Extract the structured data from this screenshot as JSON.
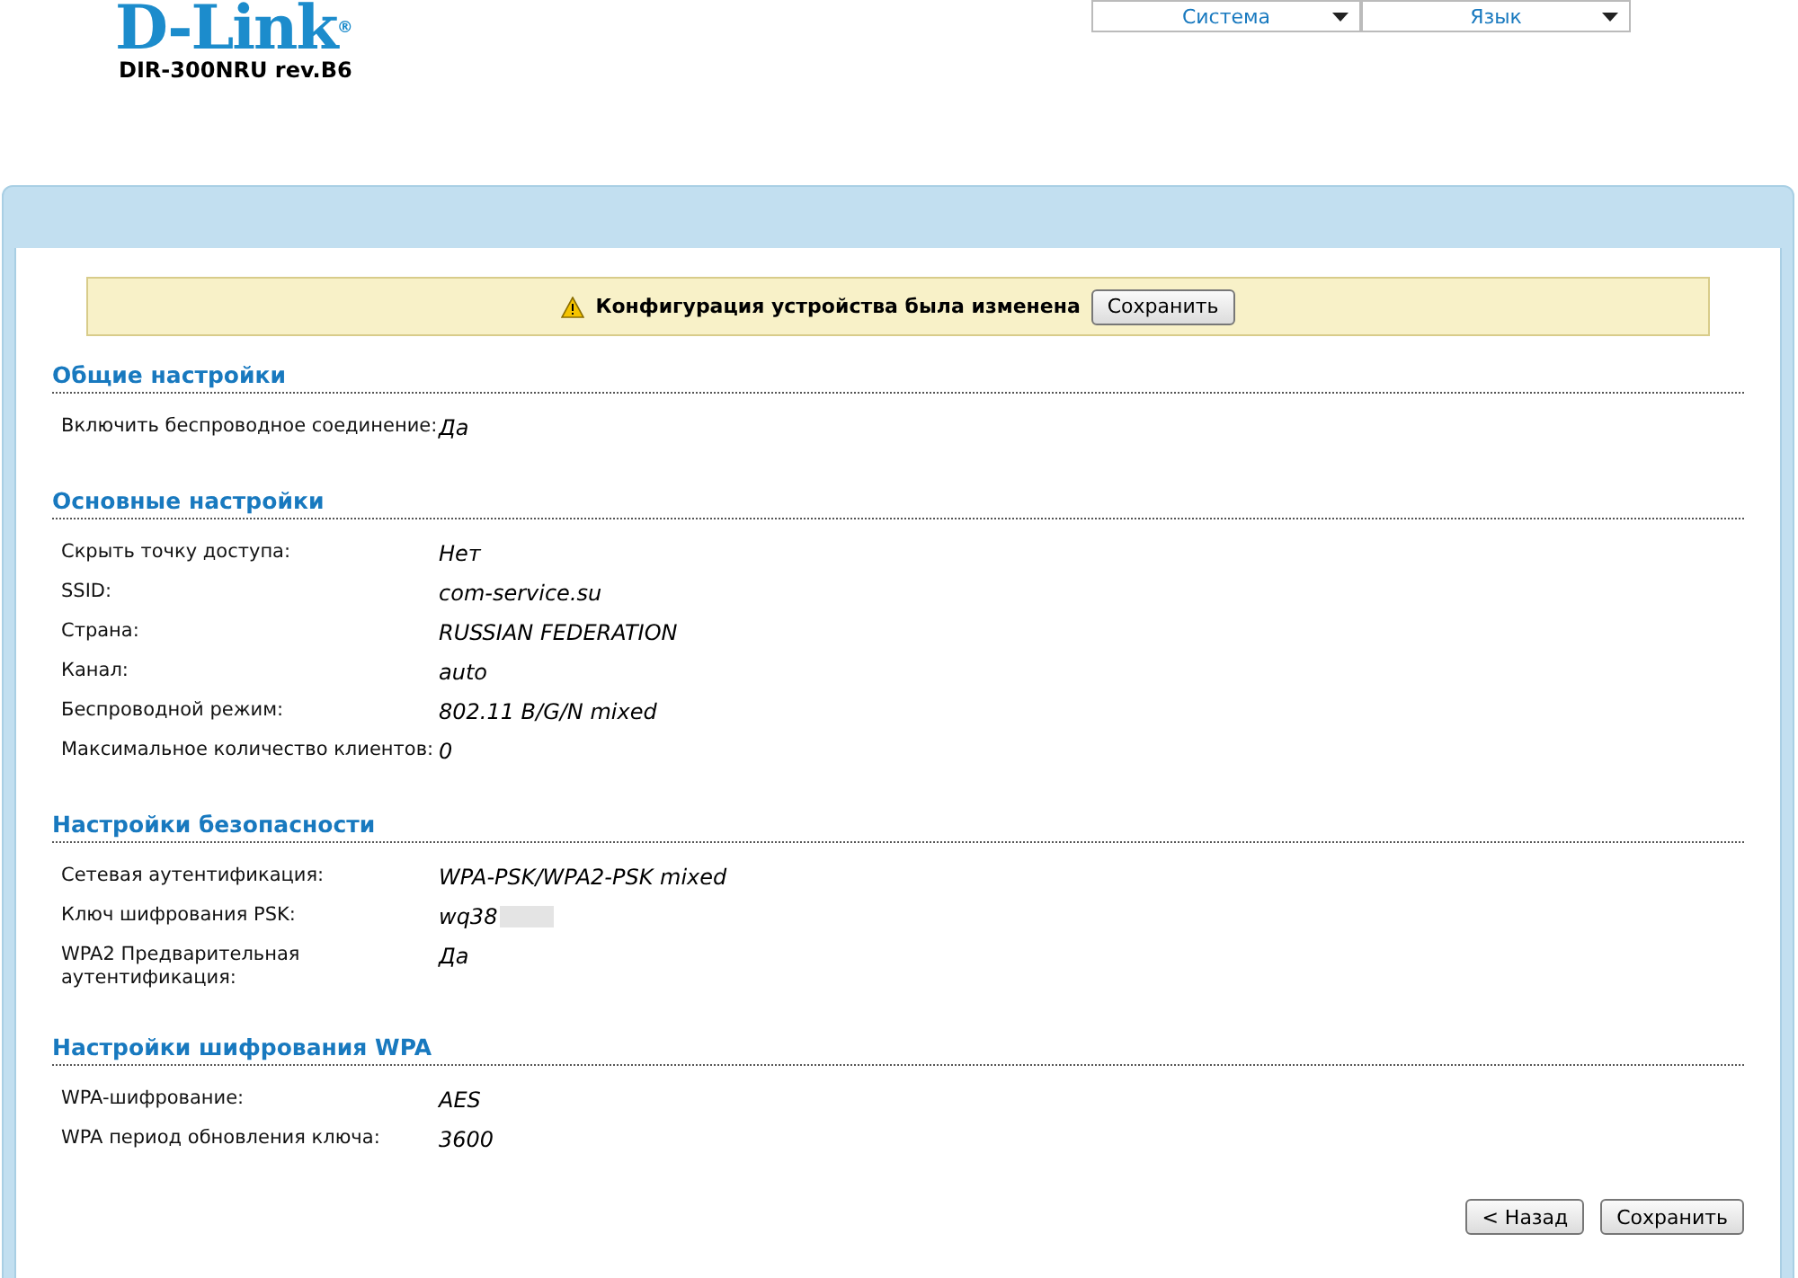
{
  "header": {
    "logo": "D-Link",
    "logo_mark": "®",
    "model": "DIR-300NRU rev.B6",
    "menus": [
      {
        "label": "Система"
      },
      {
        "label": "Язык"
      }
    ]
  },
  "notice": {
    "text": "Конфигурация устройства была изменена",
    "button": "Сохранить"
  },
  "sections": [
    {
      "title": "Общие настройки",
      "rows": [
        {
          "label": "Включить беспроводное соединение:",
          "value": "Да"
        }
      ]
    },
    {
      "title": "Основные настройки",
      "rows": [
        {
          "label": "Скрыть точку доступа:",
          "value": "Нет"
        },
        {
          "label": "SSID:",
          "value": "com-service.su"
        },
        {
          "label": "Страна:",
          "value": "RUSSIAN FEDERATION"
        },
        {
          "label": "Канал:",
          "value": "auto"
        },
        {
          "label": "Беспроводной режим:",
          "value": "802.11 B/G/N mixed"
        },
        {
          "label": "Максимальное количество клиентов:",
          "value": "0"
        }
      ]
    },
    {
      "title": "Настройки безопасности",
      "rows": [
        {
          "label": "Сетевая аутентификация:",
          "value": "WPA-PSK/WPA2-PSK mixed"
        },
        {
          "label": "Ключ шифрования PSK:",
          "value": "wq38",
          "redacted": true
        },
        {
          "label": "WPA2 Предварительная аутентификация:",
          "value": "Да"
        }
      ]
    },
    {
      "title": "Настройки шифрования WPA",
      "rows": [
        {
          "label": "WPA-шифрование:",
          "value": "AES"
        },
        {
          "label": "WPA период обновления ключа:",
          "value": "3600"
        }
      ]
    }
  ],
  "buttons": [
    {
      "label": "< Назад"
    },
    {
      "label": "Сохранить"
    }
  ]
}
